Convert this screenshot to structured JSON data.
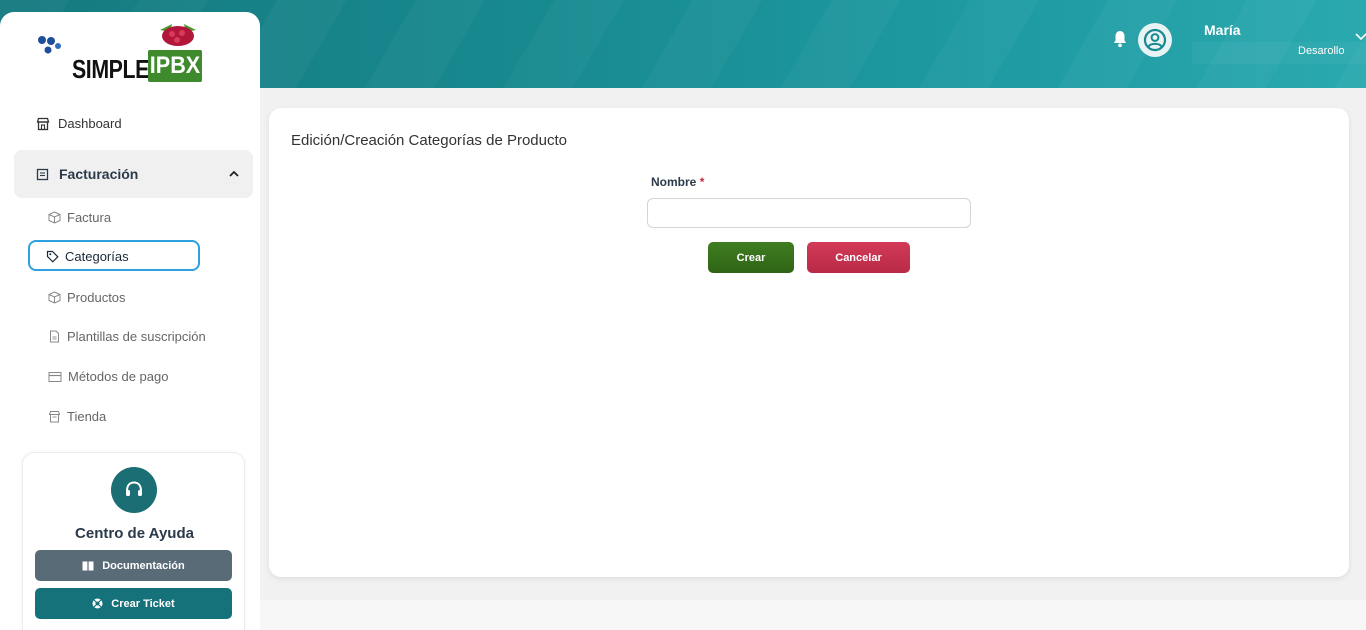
{
  "app": {
    "brand_word": "SIMPLE",
    "brand_badge": "IPBX"
  },
  "header": {
    "user_name": "María",
    "user_role": "Desarollo"
  },
  "sidebar": {
    "dashboard_label": "Dashboard",
    "group_label": "Facturación",
    "items": [
      {
        "label": "Factura",
        "icon": "box-icon"
      },
      {
        "label": "Categorías",
        "icon": "tag-icon",
        "active": true
      },
      {
        "label": "Productos",
        "icon": "box-icon"
      },
      {
        "label": "Plantillas de suscripción",
        "icon": "document-icon"
      },
      {
        "label": "Métodos de pago",
        "icon": "credit-card-icon"
      },
      {
        "label": "Tienda",
        "icon": "store-icon"
      }
    ]
  },
  "help": {
    "title": "Centro de Ayuda",
    "docs_label": "Documentación",
    "ticket_label": "Crear Ticket"
  },
  "main": {
    "title": "Edición/Creación Categorías de Producto",
    "field_label": "Nombre",
    "required_mark": "*",
    "field_value": "",
    "create_label": "Crear",
    "cancel_label": "Cancelar"
  },
  "colors": {
    "header_teal": "#178a90",
    "active_border": "#2ea0e0",
    "create_green": "#3a7520",
    "cancel_red": "#c8334f",
    "help_teal": "#16727a"
  }
}
